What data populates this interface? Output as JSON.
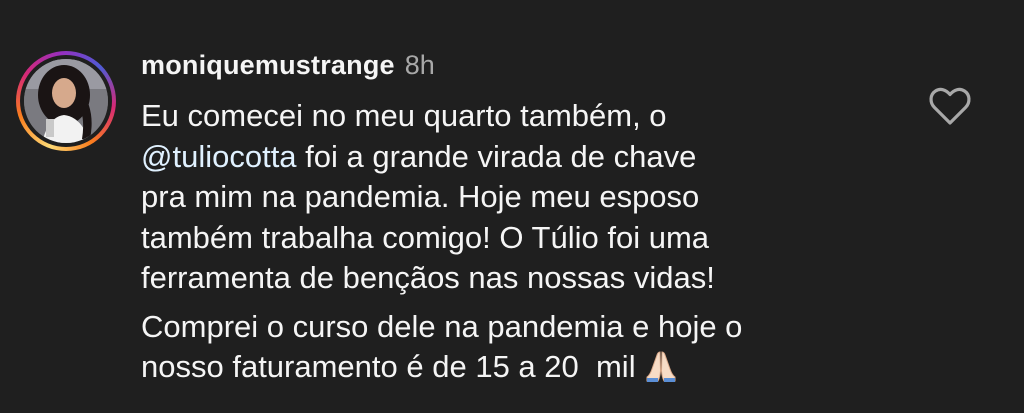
{
  "comment": {
    "username": "moniquemustrange",
    "timestamp": "8h",
    "paragraph1": {
      "line1": "Eu comecei no meu quarto também, o",
      "mention": "@tuliocotta",
      "line2_rest": " foi a grande virada de chave",
      "line3": "pra mim na pandemia. Hoje meu esposo",
      "line4": "também trabalha comigo! O Túlio foi uma",
      "line5": "ferramenta de bençãos nas nossas vidas!"
    },
    "paragraph2": {
      "line1": "Comprei o curso dele na pandemia e hoje o",
      "line2": "nosso faturamento é de 15 a 20  mil"
    },
    "emoji_icon": "praying-hands-icon",
    "like_icon": "heart-outline-icon"
  },
  "colors": {
    "background": "#1f1f1f",
    "text": "#f5f5f5",
    "muted": "#a8a8a8",
    "mention": "#e0f1ff"
  }
}
